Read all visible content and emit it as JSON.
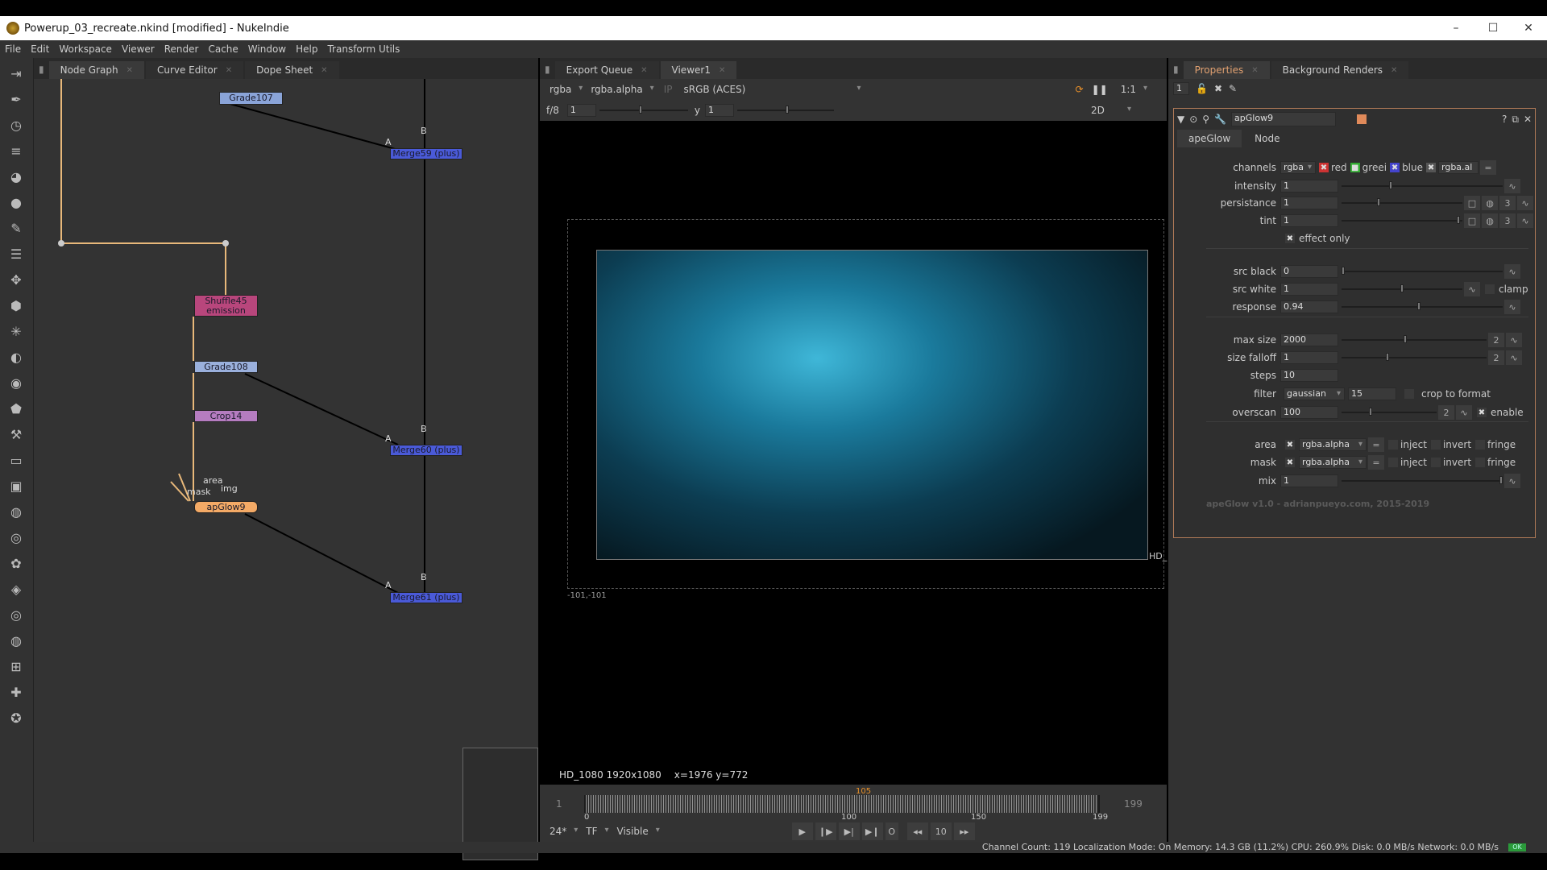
{
  "window": {
    "title": "Powerup_03_recreate.nkind [modified] - NukeIndie",
    "min": "–",
    "max": "☐",
    "close": "✕"
  },
  "menu": [
    "File",
    "Edit",
    "Workspace",
    "Viewer",
    "Render",
    "Cache",
    "Window",
    "Help",
    "Transform Utils"
  ],
  "left_tools": [
    "import-icon",
    "pen-icon",
    "clock-icon",
    "layers-icon",
    "color-icon",
    "sphere-icon",
    "paint-icon",
    "stack-icon",
    "move-icon",
    "cube-icon",
    "particles-icon",
    "deep-icon",
    "eye-icon",
    "tag-icon",
    "wrench-icon",
    "folder-icon",
    "gallery-icon",
    "globe-icon",
    "gauge-icon",
    "flower-icon",
    "cup-icon",
    "target-icon",
    "globe2-icon",
    "grid-icon",
    "pin-icon",
    "plugin-icon"
  ],
  "nodegraph": {
    "tabs": [
      "Node Graph",
      "Curve Editor",
      "Dope Sheet"
    ],
    "nodes": {
      "grade107": "Grade107",
      "merge59": "Merge59 (plus)",
      "shuffle45": "Shuffle45",
      "shuffle45_sub": "emission",
      "grade108": "Grade108",
      "crop14": "Crop14",
      "apglow9": "apGlow9",
      "merge60": "Merge60 (plus)",
      "merge61": "Merge61 (plus)"
    },
    "inputs": {
      "a": "A",
      "b": "B",
      "area": "area",
      "mask": "mask",
      "img": "img"
    }
  },
  "viewer": {
    "tabs": [
      "Export Queue",
      "Viewer1"
    ],
    "channels": "rgba",
    "alpha": "rgba.alpha",
    "ip": "IP",
    "lut": "sRGB (ACES)",
    "zoom": "1:1",
    "fstop": "f/8",
    "gain": "1",
    "gamma_label": "y",
    "gamma": "1",
    "mode": "2D",
    "format_label": "HD_",
    "bbox_label": "-101,-101",
    "info": "HD_1080 1920x1080",
    "coords": "x=1976 y=772",
    "timeline": {
      "start": "1",
      "end": "199",
      "current": "105",
      "ticks": [
        "0",
        "100",
        "150",
        "199"
      ],
      "fps": "24*",
      "tf": "TF",
      "visible": "Visible",
      "step": "10"
    }
  },
  "properties": {
    "tabs": [
      "Properties",
      "Background Renders"
    ],
    "max_panels": "1",
    "node_name": "apGlow9",
    "node_tabs": [
      "apeGlow",
      "Node"
    ],
    "channels": {
      "label": "channels",
      "value": "rgba",
      "red": "red",
      "green": "greei",
      "blue": "blue",
      "alpha": "rgba.al"
    },
    "params": [
      {
        "label": "intensity",
        "value": "1",
        "pos": 0.3
      },
      {
        "label": "persistance",
        "value": "1",
        "pos": 0.3
      },
      {
        "label": "tint",
        "value": "1",
        "pos": 0.98
      },
      {
        "label": "src black",
        "value": "0",
        "pos": 0.0
      },
      {
        "label": "src white",
        "value": "1",
        "pos": 0.5
      },
      {
        "label": "response",
        "value": "0.94",
        "pos": 0.48
      },
      {
        "label": "max size",
        "value": "2000",
        "pos": 0.44
      },
      {
        "label": "size falloff",
        "value": "1",
        "pos": 0.31
      },
      {
        "label": "steps",
        "value": "10"
      },
      {
        "label": "overscan",
        "value": "100",
        "pos": 0.3
      },
      {
        "label": "mix",
        "value": "1",
        "pos": 1.0
      }
    ],
    "effect_only": "effect only",
    "clamp": "clamp",
    "filter": {
      "label": "filter",
      "value": "gaussian",
      "size": "15",
      "crop": "crop to format"
    },
    "enable": "enable",
    "color_count": "3",
    "dims": "2",
    "area": {
      "label": "area",
      "value": "rgba.alpha"
    },
    "mask": {
      "label": "mask",
      "value": "rgba.alpha"
    },
    "inject": "inject",
    "invert": "invert",
    "fringe": "fringe",
    "credit": "apeGlow v1.0 - adrianpueyo.com, 2015-2019"
  },
  "status": {
    "text": "Channel Count: 119  Localization Mode: On  Memory: 14.3 GB (11.2%)  CPU: 260.9%  Disk: 0.0 MB/s  Network: 0.0 MB/s",
    "ok": "OK"
  }
}
